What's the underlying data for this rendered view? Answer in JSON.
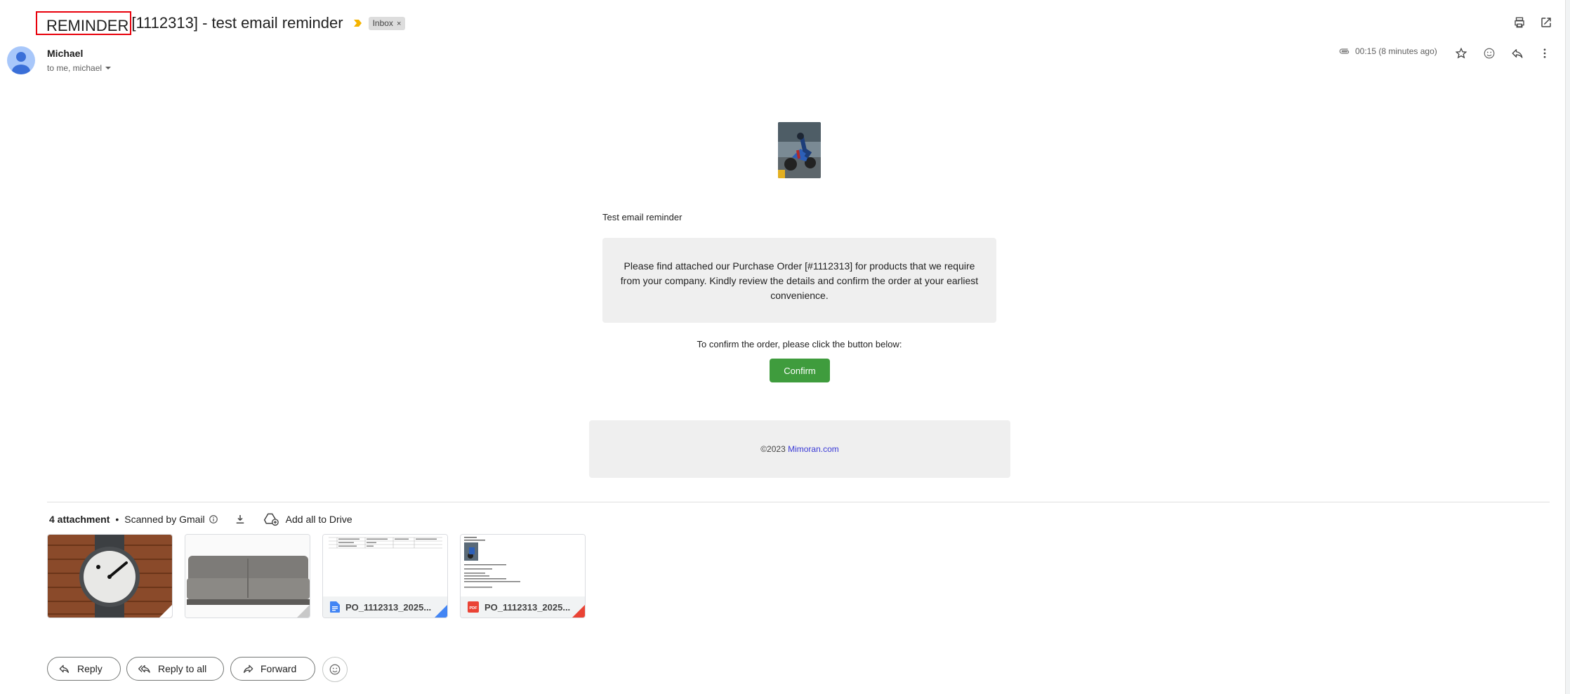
{
  "subject": {
    "highlighted": "REMINDER",
    "rest": "[1112313] - test email reminder",
    "label": "Inbox"
  },
  "sender": {
    "name": "Michael",
    "to_line": "to me, michael",
    "time": "00:15 (8 minutes ago)"
  },
  "body": {
    "greeting": "Test email reminder",
    "message": "Please find attached our Purchase Order [#1112313] for products that we require from your company. Kindly review the details and confirm the order at your earliest convenience.",
    "confirm_prompt": "To confirm the order, please click the button below:",
    "confirm_label": "Confirm",
    "footer_copy": "©2023",
    "footer_link": "Mimoran.com"
  },
  "attachments": {
    "count": "4 attachment",
    "scanned": "Scanned by Gmail",
    "add_all": "Add all to Drive",
    "files": [
      {
        "kind": "image",
        "name": "watch"
      },
      {
        "kind": "image",
        "name": "sofa"
      },
      {
        "kind": "doc",
        "name": "PO_1112313_2025..."
      },
      {
        "kind": "pdf",
        "name": "PO_1112313_2025..."
      }
    ]
  },
  "actions": {
    "reply": "Reply",
    "reply_all": "Reply to all",
    "forward": "Forward"
  },
  "colors": {
    "confirm_green": "#3f9c3d",
    "highlight_red": "#e8000b",
    "doc_blue": "#4285f4",
    "pdf_red": "#ea4335"
  }
}
